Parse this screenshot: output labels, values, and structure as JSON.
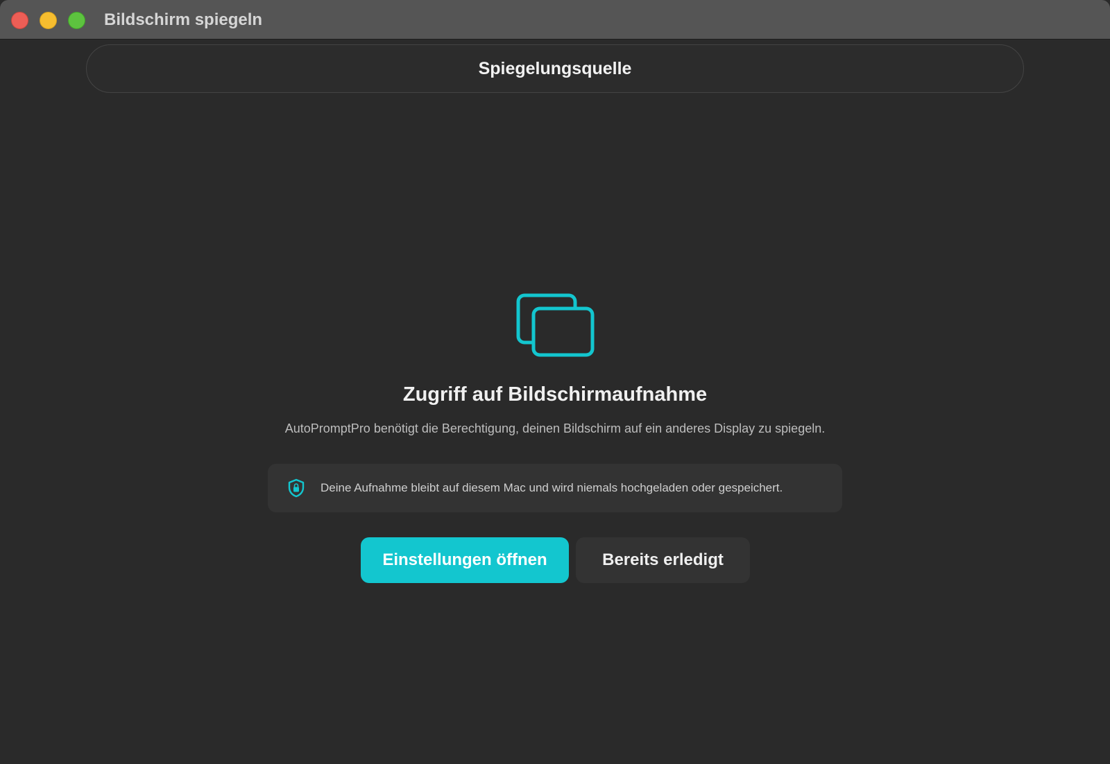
{
  "window": {
    "title": "Bildschirm spiegeln"
  },
  "source_bar": {
    "label": "Spiegelungsquelle"
  },
  "permission": {
    "icon": "screens-icon",
    "heading": "Zugriff auf Bildschirmaufnahme",
    "description": "AutoPromptPro benötigt die Berechtigung, deinen Bildschirm auf ein anderes Display zu spiegeln.",
    "notice": {
      "icon": "shield-lock-icon",
      "text": "Deine Aufnahme bleibt auf diesem Mac und wird niemals hochgeladen oder gespeichert."
    }
  },
  "actions": {
    "open_settings_label": "Einstellungen öffnen",
    "already_done_label": "Bereits erledigt"
  },
  "colors": {
    "accent": "#13c6cf",
    "background": "#2a2a2a",
    "titlebar": "#555555"
  }
}
